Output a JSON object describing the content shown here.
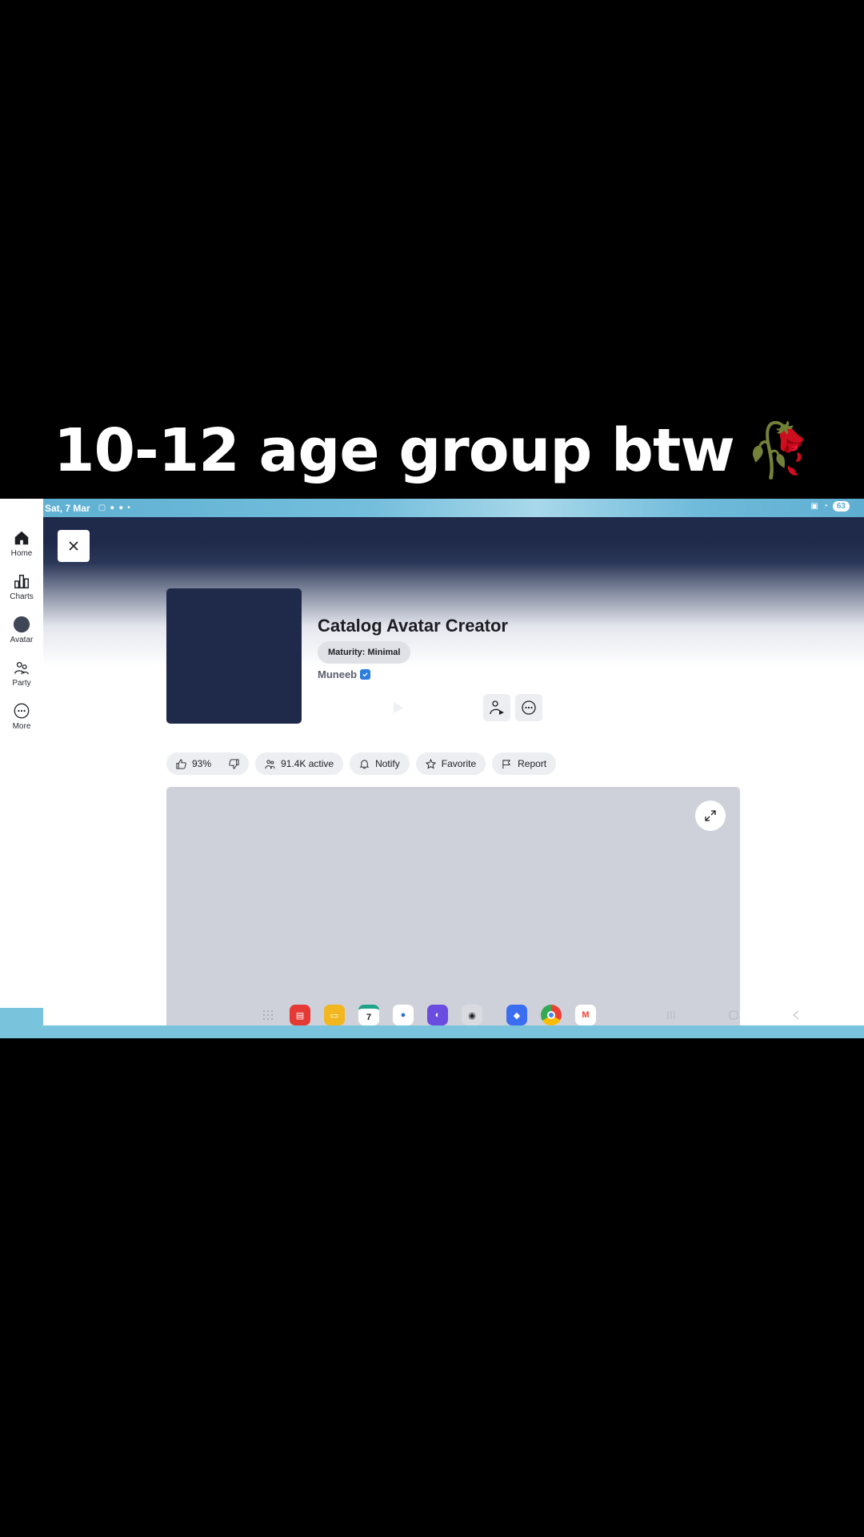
{
  "caption": {
    "text": "10-12 age group btw",
    "emoji": "🥀"
  },
  "status_bar": {
    "date": "Sat, 7 Mar",
    "battery": "63"
  },
  "nav_rail": {
    "items": [
      {
        "label": "Home",
        "icon": "home-icon"
      },
      {
        "label": "Charts",
        "icon": "charts-icon"
      },
      {
        "label": "Avatar",
        "icon": "avatar-icon"
      },
      {
        "label": "Party",
        "icon": "party-icon"
      },
      {
        "label": "More",
        "icon": "more-icon"
      }
    ]
  },
  "game": {
    "title": "Catalog Avatar Creator",
    "maturity": "Maturity: Minimal",
    "creator": "Muneeb"
  },
  "stats": {
    "rating": "93%",
    "active": "91.4K active",
    "notify": "Notify",
    "favorite": "Favorite",
    "report": "Report"
  },
  "dock": {
    "apps": [
      "app-drawer",
      "notes",
      "my-files",
      "calendar",
      "messages",
      "browser",
      "camera",
      "roblox",
      "chrome",
      "gmail"
    ],
    "calendar_day": "7"
  },
  "colors": {
    "header_navy": "#1f2a4a",
    "thumbnail": "#1f2a4b",
    "verified_blue": "#2b7de0",
    "status_blue": "#5fb0d3"
  }
}
